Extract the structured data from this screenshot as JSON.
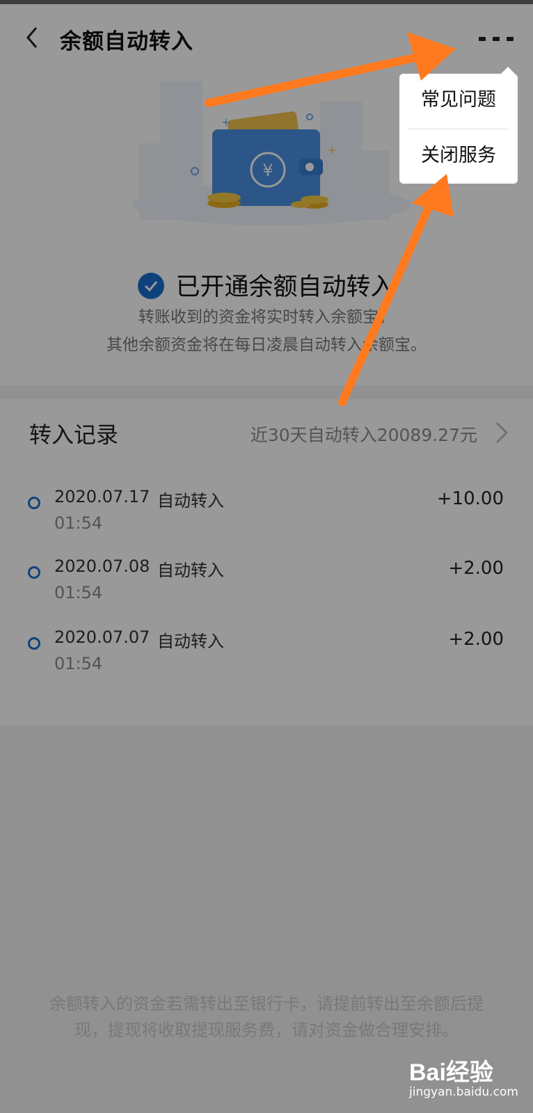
{
  "header": {
    "title": "余额自动转入",
    "back_icon": "chevron-left-icon",
    "more_icon": "more-icon"
  },
  "status": {
    "text": "已开通余额自动转入",
    "icon": "check-circle-icon",
    "color": "#1a6fd0"
  },
  "description": [
    "转账收到的资金将实时转入余额宝，",
    "其他余额资金将在每日凌晨自动转入余额宝。"
  ],
  "records": {
    "title": "转入记录",
    "summary": "近30天自动转入20089.27元",
    "items": [
      {
        "date": "2020.07.17",
        "type": "自动转入",
        "time": "01:54",
        "amount": "+10.00"
      },
      {
        "date": "2020.07.08",
        "type": "自动转入",
        "time": "01:54",
        "amount": "+2.00"
      },
      {
        "date": "2020.07.07",
        "type": "自动转入",
        "time": "01:54",
        "amount": "+2.00"
      }
    ]
  },
  "note": "余额转入的资金若需转出至银行卡，请提前转出至余额后提现，提现将收取提现服务费，请对资金做合理安排。",
  "menu": {
    "items": [
      {
        "label": "常见问题"
      },
      {
        "label": "关闭服务"
      }
    ]
  },
  "watermark": {
    "logo": "Bai经验",
    "url": "jingyan.baidu.com"
  },
  "colors": {
    "accent": "#1a6fd0",
    "arrow": "#ff7a1f"
  }
}
